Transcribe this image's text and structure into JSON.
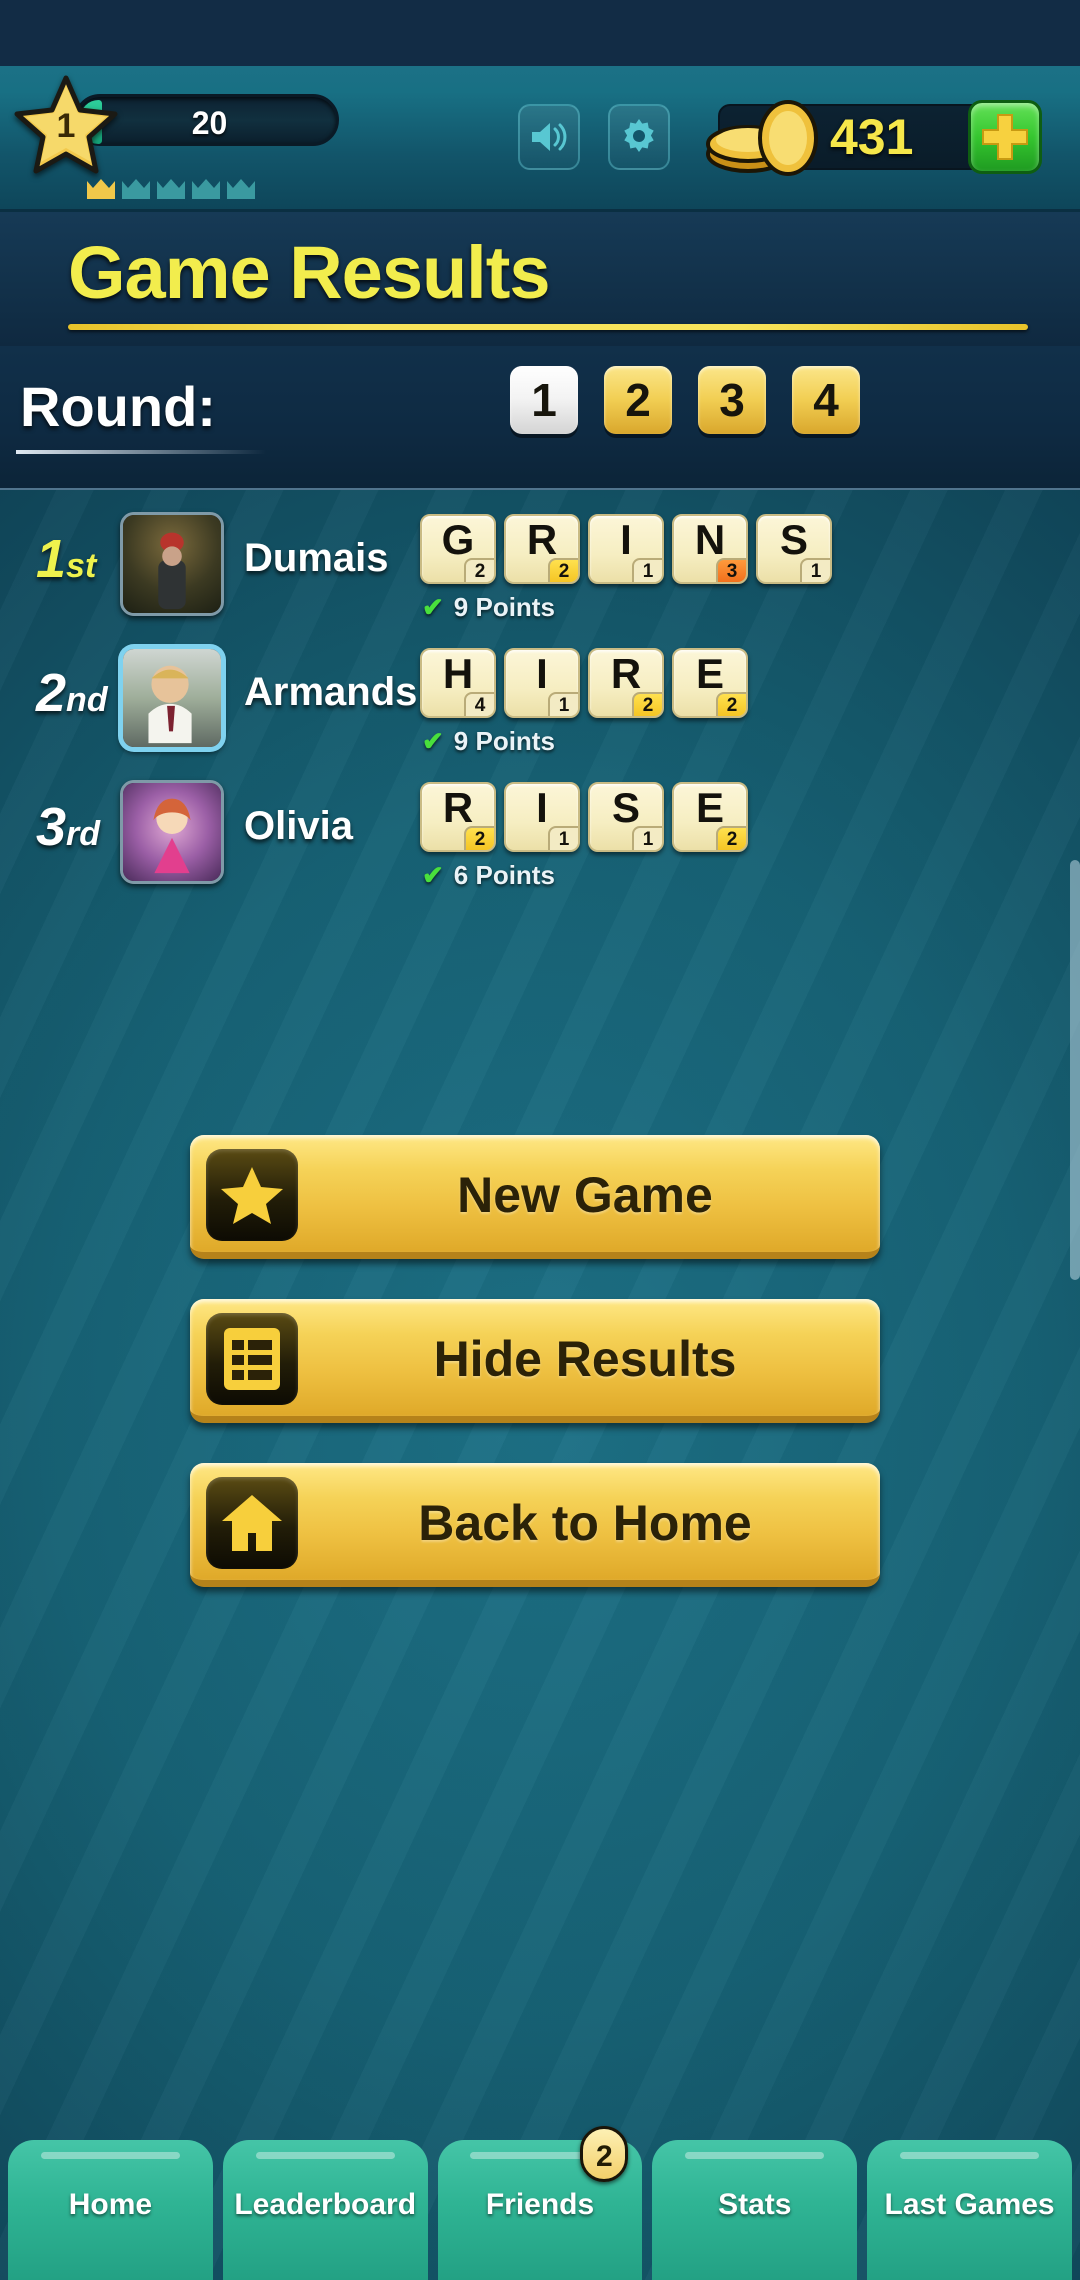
{
  "hud": {
    "level": "1",
    "xp": "20",
    "coins": "431",
    "crowns_total": 5,
    "crowns_filled": 1,
    "sound_icon": "speaker-icon",
    "settings_icon": "gear-icon",
    "add_coins_icon": "plus-icon",
    "colors": {
      "coin_text": "#f6e74a",
      "add_button": "#35c62f"
    }
  },
  "header": {
    "title": "Game Results",
    "accent": "#f2ed4d"
  },
  "round": {
    "label": "Round:",
    "tabs": [
      "1",
      "2",
      "3",
      "4"
    ],
    "selected": "1"
  },
  "results": [
    {
      "rank": "1",
      "rank_suffix": "st",
      "rank_style": "gold",
      "name": "Dumais",
      "is_me": false,
      "points": "9 Points",
      "word": "GRINS",
      "tiles": [
        {
          "letter": "G",
          "value": "2",
          "highlight": "none"
        },
        {
          "letter": "R",
          "value": "2",
          "highlight": "gold"
        },
        {
          "letter": "I",
          "value": "1",
          "highlight": "none"
        },
        {
          "letter": "N",
          "value": "3",
          "highlight": "orange"
        },
        {
          "letter": "S",
          "value": "1",
          "highlight": "none"
        }
      ]
    },
    {
      "rank": "2",
      "rank_suffix": "nd",
      "rank_style": "plain",
      "name": "Armands",
      "is_me": true,
      "points": "9 Points",
      "word": "HIRE",
      "tiles": [
        {
          "letter": "H",
          "value": "4",
          "highlight": "none"
        },
        {
          "letter": "I",
          "value": "1",
          "highlight": "none"
        },
        {
          "letter": "R",
          "value": "2",
          "highlight": "gold"
        },
        {
          "letter": "E",
          "value": "2",
          "highlight": "gold"
        }
      ]
    },
    {
      "rank": "3",
      "rank_suffix": "rd",
      "rank_style": "plain",
      "name": "Olivia",
      "is_me": false,
      "points": "6 Points",
      "word": "RISE",
      "tiles": [
        {
          "letter": "R",
          "value": "2",
          "highlight": "gold"
        },
        {
          "letter": "I",
          "value": "1",
          "highlight": "none"
        },
        {
          "letter": "S",
          "value": "1",
          "highlight": "none"
        },
        {
          "letter": "E",
          "value": "2",
          "highlight": "gold"
        }
      ]
    }
  ],
  "actions": [
    {
      "label": "New Game",
      "icon": "star-icon"
    },
    {
      "label": "Hide Results",
      "icon": "list-icon"
    },
    {
      "label": "Back to Home",
      "icon": "home-icon"
    }
  ],
  "bottom_nav": [
    {
      "label": "Home",
      "badge": null
    },
    {
      "label": "Leaderboard",
      "badge": null
    },
    {
      "label": "Friends",
      "badge": "2"
    },
    {
      "label": "Stats",
      "badge": null
    },
    {
      "label": "Last Games",
      "badge": null
    }
  ]
}
